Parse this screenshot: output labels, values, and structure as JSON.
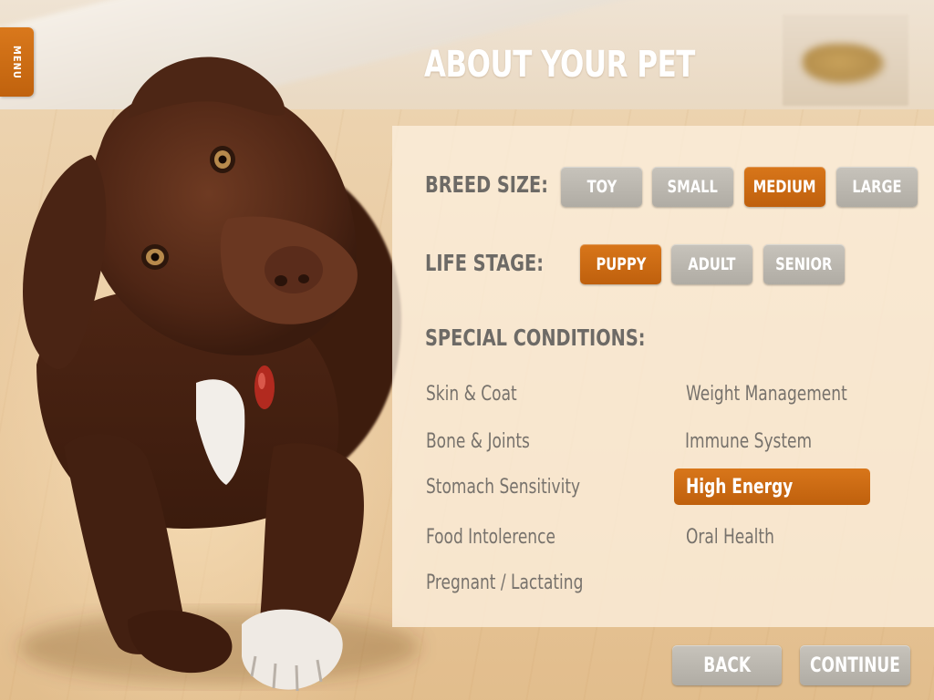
{
  "menu": {
    "label": "MENU"
  },
  "title": "ABOUT YOUR PET",
  "breed_size": {
    "label": "BREED SIZE:",
    "options": [
      "TOY",
      "SMALL",
      "MEDIUM",
      "LARGE"
    ],
    "selected": "MEDIUM"
  },
  "life_stage": {
    "label": "LIFE STAGE:",
    "options": [
      "PUPPY",
      "ADULT",
      "SENIOR"
    ],
    "selected": "PUPPY"
  },
  "special_conditions": {
    "label": "SPECIAL CONDITIONS:",
    "items": [
      "Skin & Coat",
      "Weight Management",
      "Bone & Joints",
      "Immune System",
      "Stomach Sensitivity",
      "High Energy",
      "Food Intolerence",
      "Oral Health",
      "Pregnant / Lactating"
    ],
    "selected": "High Energy"
  },
  "nav": {
    "back": "BACK",
    "continue": "CONTINUE"
  },
  "colors": {
    "accent": "#cc6b12",
    "button_gray": "#bcb8b0",
    "label": "#6d6a66"
  },
  "icons": {
    "thumbnail": "food-thumbnail-image",
    "hero": "dog-photo"
  }
}
